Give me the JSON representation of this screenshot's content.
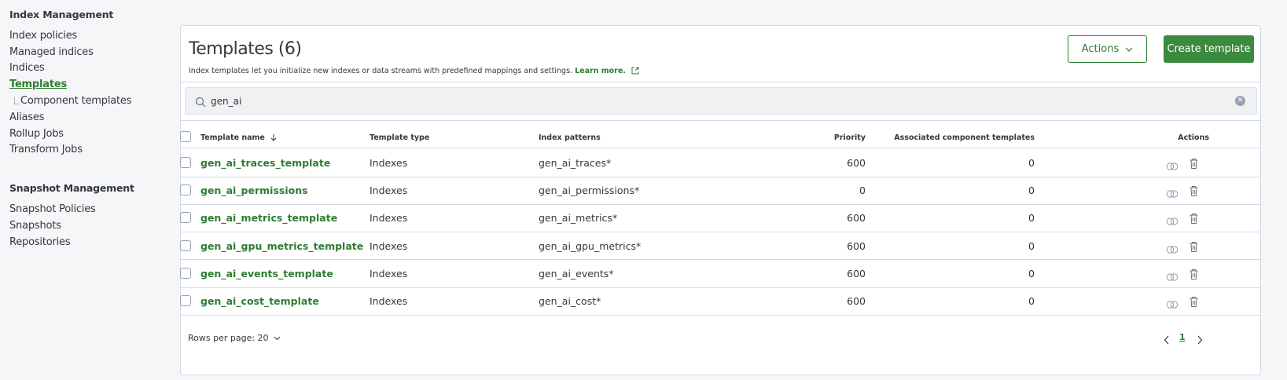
{
  "sidebar": {
    "index_management_heading": "Index Management",
    "items": [
      {
        "label": "Index policies"
      },
      {
        "label": "Managed indices"
      },
      {
        "label": "Indices"
      },
      {
        "label": "Templates"
      },
      {
        "label": "Component templates"
      },
      {
        "label": "Aliases"
      },
      {
        "label": "Rollup Jobs"
      },
      {
        "label": "Transform Jobs"
      }
    ],
    "snapshot_heading": "Snapshot Management",
    "snapshot_items": [
      {
        "label": "Snapshot Policies"
      },
      {
        "label": "Snapshots"
      },
      {
        "label": "Repositories"
      }
    ]
  },
  "page": {
    "title": "Templates (6)",
    "description": "Index templates let you initialize new indexes or data streams with predefined mappings and settings.",
    "learn_more": "Learn more.",
    "actions_button": "Actions",
    "create_button": "Create template"
  },
  "search": {
    "value": "gen_ai"
  },
  "table": {
    "headers": {
      "name": "Template name",
      "type": "Template type",
      "patterns": "Index patterns",
      "priority": "Priority",
      "components": "Associated component templates",
      "actions": "Actions"
    },
    "rows": [
      {
        "name": "gen_ai_traces_template",
        "type": "Indexes",
        "pattern": "gen_ai_traces*",
        "priority": "600",
        "components": "0"
      },
      {
        "name": "gen_ai_permissions",
        "type": "Indexes",
        "pattern": "gen_ai_permissions*",
        "priority": "0",
        "components": "0"
      },
      {
        "name": "gen_ai_metrics_template",
        "type": "Indexes",
        "pattern": "gen_ai_metrics*",
        "priority": "600",
        "components": "0"
      },
      {
        "name": "gen_ai_gpu_metrics_template",
        "type": "Indexes",
        "pattern": "gen_ai_gpu_metrics*",
        "priority": "600",
        "components": "0"
      },
      {
        "name": "gen_ai_events_template",
        "type": "Indexes",
        "pattern": "gen_ai_events*",
        "priority": "600",
        "components": "0"
      },
      {
        "name": "gen_ai_cost_template",
        "type": "Indexes",
        "pattern": "gen_ai_cost*",
        "priority": "600",
        "components": "0"
      }
    ]
  },
  "pagination": {
    "rows_per_page": "Rows per page: 20",
    "current_page": "1"
  },
  "colors": {
    "accent": "#2e7d32",
    "primary_button": "#3b8a3e",
    "border": "#d3dae6"
  }
}
